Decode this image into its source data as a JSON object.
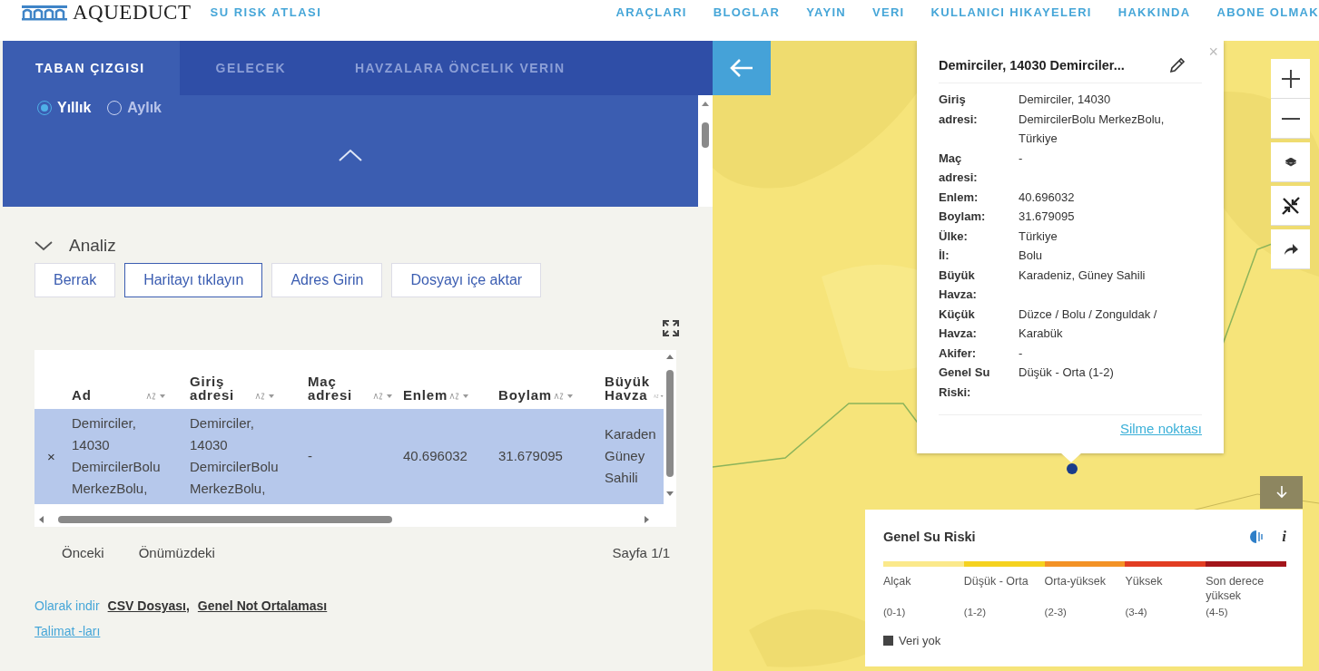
{
  "header": {
    "logo": "AQUEDUCT",
    "subtitle": "SU RISK ATLASI",
    "nav": [
      "ARAÇLARI",
      "BLOGLAR",
      "YAYIN",
      "VERI",
      "KULLANICI HIKAYELERI",
      "HAKKINDA",
      "ABONE OLMAK"
    ]
  },
  "panel": {
    "tabs": [
      {
        "label": "TABAN ÇIZGISI",
        "selected": true
      },
      {
        "label": "GELECEK",
        "selected": false
      },
      {
        "label": "HAVZALARA ÖNCELIK VERIN",
        "selected": false
      }
    ],
    "periods": [
      {
        "label": "Yıllık",
        "selected": true
      },
      {
        "label": "Aylık",
        "selected": false
      }
    ],
    "analysis": {
      "title": "Analiz",
      "expanded": true,
      "buttons": [
        {
          "label": "Berrak",
          "selected": false
        },
        {
          "label": "Haritayı tıklayın",
          "selected": true
        },
        {
          "label": "Adres Girin",
          "selected": false
        },
        {
          "label": "Dosyayı içe aktar",
          "selected": false
        }
      ]
    },
    "table": {
      "columns": [
        "Ad",
        "Giriş adresi",
        "Maç adresi",
        "Enlem",
        "Boylam",
        "Büyük Havza"
      ],
      "rows": [
        {
          "selected": true,
          "remove": "×",
          "cells": [
            "Demirciler, 14030 DemircilerBolu MerkezBolu,",
            "Demirciler, 14030 DemircilerBolu MerkezBolu,",
            "-",
            "40.696032",
            "31.679095",
            "Karaden Güney Sahili"
          ]
        }
      ]
    },
    "pager": {
      "previous": "Önceki",
      "next": "Önümüzdeki",
      "page": "Sayfa 1/1"
    },
    "download": {
      "label": "Olarak indir",
      "links": [
        "CSV Dosyası,",
        "Genel Not Ortalaması"
      ]
    },
    "instructions": "Talimat -ları"
  },
  "map": {
    "kind": "picture",
    "popup": {
      "title": "Demirciler, 14030 Demirciler...",
      "close": "×",
      "fields": [
        {
          "label": "Giriş adresi:",
          "value": "Demirciler, 14030 DemircilerBolu MerkezBolu, Türkiye"
        },
        {
          "label": "Maç adresi:",
          "value": "-"
        },
        {
          "label": "Enlem:",
          "value": "40.696032"
        },
        {
          "label": "Boylam:",
          "value": "31.679095"
        },
        {
          "label": "Ülke:",
          "value": "Türkiye"
        },
        {
          "label": "İl:",
          "value": "Bolu"
        },
        {
          "label": "Büyük Havza:",
          "value": "Karadeniz, Güney Sahili"
        },
        {
          "label": "Küçük Havza:",
          "value": "Düzce / Bolu / Zonguldak / Karabük"
        },
        {
          "label": "Akifer:",
          "value": "-"
        },
        {
          "label": "Genel Su Riski:",
          "value": "Düşük - Orta (1-2)"
        }
      ],
      "action": "Silme noktası"
    },
    "legend": {
      "title": "Genel Su Riski",
      "info": "i",
      "classes": [
        {
          "label": "Alçak",
          "range": "(0-1)",
          "color": "#fbe98b"
        },
        {
          "label": "Düşük - Orta",
          "range": "(1-2)",
          "color": "#f5d21f"
        },
        {
          "label": "Orta-yüksek",
          "range": "(2-3)",
          "color": "#f39226"
        },
        {
          "label": "Yüksek",
          "range": "(3-4)",
          "color": "#e23d22"
        },
        {
          "label": "Son derece yüksek",
          "range": "(4-5)",
          "color": "#a3151a"
        }
      ],
      "no_data": "Veri yok"
    }
  }
}
